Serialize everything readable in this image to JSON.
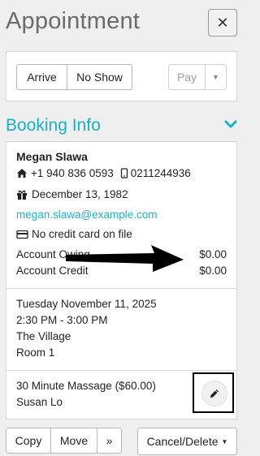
{
  "header": {
    "title": "Appointment",
    "close_label": "✕"
  },
  "actions": {
    "arrive_label": "Arrive",
    "no_show_label": "No Show",
    "pay_label": "Pay",
    "pay_caret": "▼"
  },
  "booking": {
    "section_title": "Booking Info",
    "client_name": "Megan Slawa",
    "home_phone": "+1 940 836 0593",
    "mobile_phone": "0211244936",
    "birthday": "December 13, 1982",
    "email": "megan.slawa@example.com",
    "credit_card_status": "No credit card on file",
    "account_owing_label": "Account Owing",
    "account_owing_value": "$0.00",
    "account_credit_label": "Account Credit",
    "account_credit_value": "$0.00",
    "date": "Tuesday November 11, 2025",
    "time": "2:30 PM - 3:00 PM",
    "location": "The Village",
    "room": "Room 1",
    "service": "30 Minute Massage ($60.00)",
    "staff": "Susan Lo"
  },
  "footer": {
    "copy_label": "Copy",
    "move_label": "Move",
    "more_label": "»",
    "cancel_label": "Cancel/Delete",
    "cancel_caret": "▼"
  },
  "colors": {
    "accent": "#1cb0c6",
    "annotation": "#000000"
  }
}
